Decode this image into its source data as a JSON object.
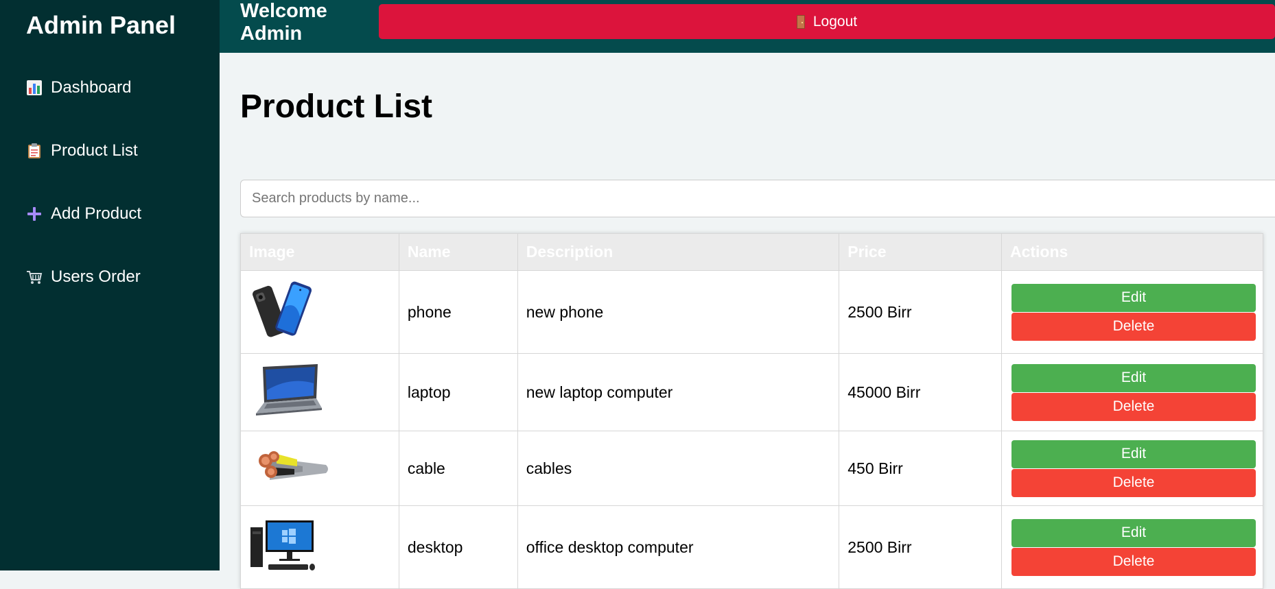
{
  "sidebar": {
    "brand": "Admin Panel",
    "items": [
      {
        "label": "Dashboard",
        "icon": "bar-chart-icon"
      },
      {
        "label": "Product List",
        "icon": "clipboard-icon"
      },
      {
        "label": "Add Product",
        "icon": "plus-icon"
      },
      {
        "label": "Users Order",
        "icon": "shopping-cart-icon"
      }
    ]
  },
  "header": {
    "welcome": "Welcome Admin",
    "logout_label": "Logout",
    "logout_icon": "door-icon"
  },
  "main": {
    "title": "Product List",
    "search_placeholder": "Search products by name...",
    "columns": [
      "Image",
      "Name",
      "Description",
      "Price",
      "Actions"
    ],
    "rows": [
      {
        "image": "phone-image",
        "name": "phone",
        "description": "new phone",
        "price": "2500 Birr"
      },
      {
        "image": "laptop-image",
        "name": "laptop",
        "description": "new laptop computer",
        "price": "45000 Birr"
      },
      {
        "image": "cable-image",
        "name": "cable",
        "description": "cables",
        "price": "450 Birr"
      },
      {
        "image": "desktop-image",
        "name": "desktop",
        "description": "office desktop computer",
        "price": "2500 Birr"
      }
    ],
    "edit_label": "Edit",
    "delete_label": "Delete"
  },
  "colors": {
    "sidebar_bg": "#022f31",
    "topbar_bg": "#044b4d",
    "logout": "#dc143c",
    "edit": "#4caf50",
    "delete": "#f44336"
  }
}
